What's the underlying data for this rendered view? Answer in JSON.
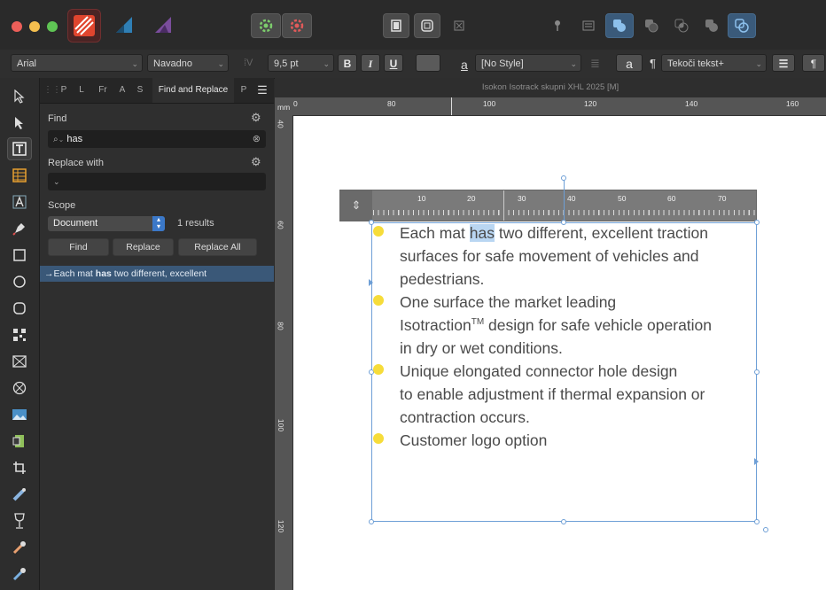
{
  "title_bar": {
    "personas": [
      "publisher-persona",
      "designer-persona",
      "photo-persona"
    ],
    "center_buttons": [
      "snapping",
      "preflight"
    ],
    "view_buttons": [
      "view-mode-normal",
      "view-mode-preview",
      "view-mode-whole"
    ]
  },
  "context_toolbar": {
    "font_family": "Arial",
    "font_style": "Navadno",
    "font_size": "9,5 pt",
    "bold_label": "B",
    "italic_label": "I",
    "underline_label": "U",
    "char_style_letter": "a",
    "char_style": "[No Style]",
    "char_button_letter": "a",
    "para_mark": "¶",
    "para_style": "Tekoči tekst+",
    "para_end_mark": "¶"
  },
  "panel": {
    "tabs": [
      "P",
      "L",
      "Fr",
      "A",
      "S",
      "Find and Replace",
      "P"
    ],
    "find_label": "Find",
    "find_value": "has",
    "replace_label": "Replace with",
    "replace_value": "",
    "scope_label": "Scope",
    "scope_value": "Document",
    "results_count": "1 results",
    "find_button": "Find",
    "replace_button": "Replace",
    "replace_all_button": "Replace All",
    "result": {
      "arrow": "→",
      "before": "Each mat ",
      "match": "has",
      "after": " two different, excellent"
    }
  },
  "document": {
    "window_title": "Isokon Isotrack skupni XHL 2025 [M]",
    "ruler_unit": "mm",
    "h_ruler": [
      "0",
      "80",
      "100",
      "120",
      "140",
      "160"
    ],
    "v_ruler": [
      "40",
      "60",
      "80",
      "100",
      "120"
    ],
    "text_ruler": [
      "10",
      "20",
      "30",
      "40",
      "50",
      "60",
      "70"
    ],
    "bullets": [
      {
        "lines": [
          {
            "pre": "Each mat ",
            "match": "has",
            "post": " two different, excellent traction"
          },
          {
            "text": "surfaces for safe movement of vehicles and"
          },
          {
            "text": "pedestrians."
          }
        ]
      },
      {
        "lines": [
          {
            "text": "One surface  the market leading"
          },
          {
            "pre": "Isotraction",
            "sup": "TM",
            "post": " design for safe vehicle operation"
          },
          {
            "text": "in dry or wet conditions."
          }
        ]
      },
      {
        "lines": [
          {
            "text": "Unique elongated connector hole design"
          },
          {
            "text": "to enable adjustment if thermal expansion or"
          },
          {
            "text": "contraction occurs."
          }
        ]
      },
      {
        "lines": [
          {
            "text": "Customer logo option"
          }
        ]
      }
    ]
  },
  "colors": {
    "accent": "#3a5878",
    "bullet": "#f6dc3a",
    "selection": "#b9d6f2"
  }
}
